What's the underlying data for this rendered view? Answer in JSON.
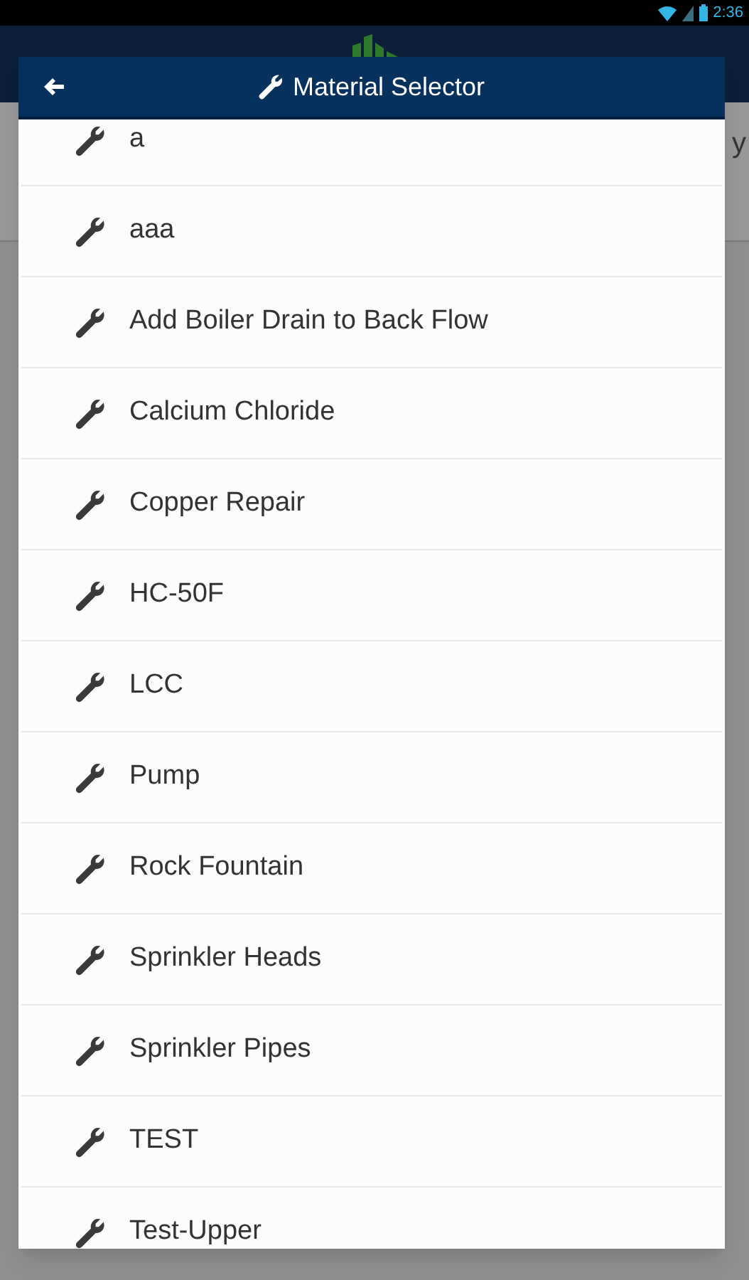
{
  "status_bar": {
    "time": "2:36"
  },
  "background": {
    "column_text": "y"
  },
  "dialog": {
    "title": "Material Selector",
    "items": [
      {
        "label": "a"
      },
      {
        "label": "aaa"
      },
      {
        "label": "Add Boiler Drain to Back Flow"
      },
      {
        "label": "Calcium Chloride"
      },
      {
        "label": "Copper Repair"
      },
      {
        "label": "HC-50F"
      },
      {
        "label": "LCC"
      },
      {
        "label": "Pump"
      },
      {
        "label": "Rock Fountain"
      },
      {
        "label": "Sprinkler Heads"
      },
      {
        "label": "Sprinkler Pipes"
      },
      {
        "label": "TEST"
      },
      {
        "label": "Test-Upper"
      }
    ]
  }
}
